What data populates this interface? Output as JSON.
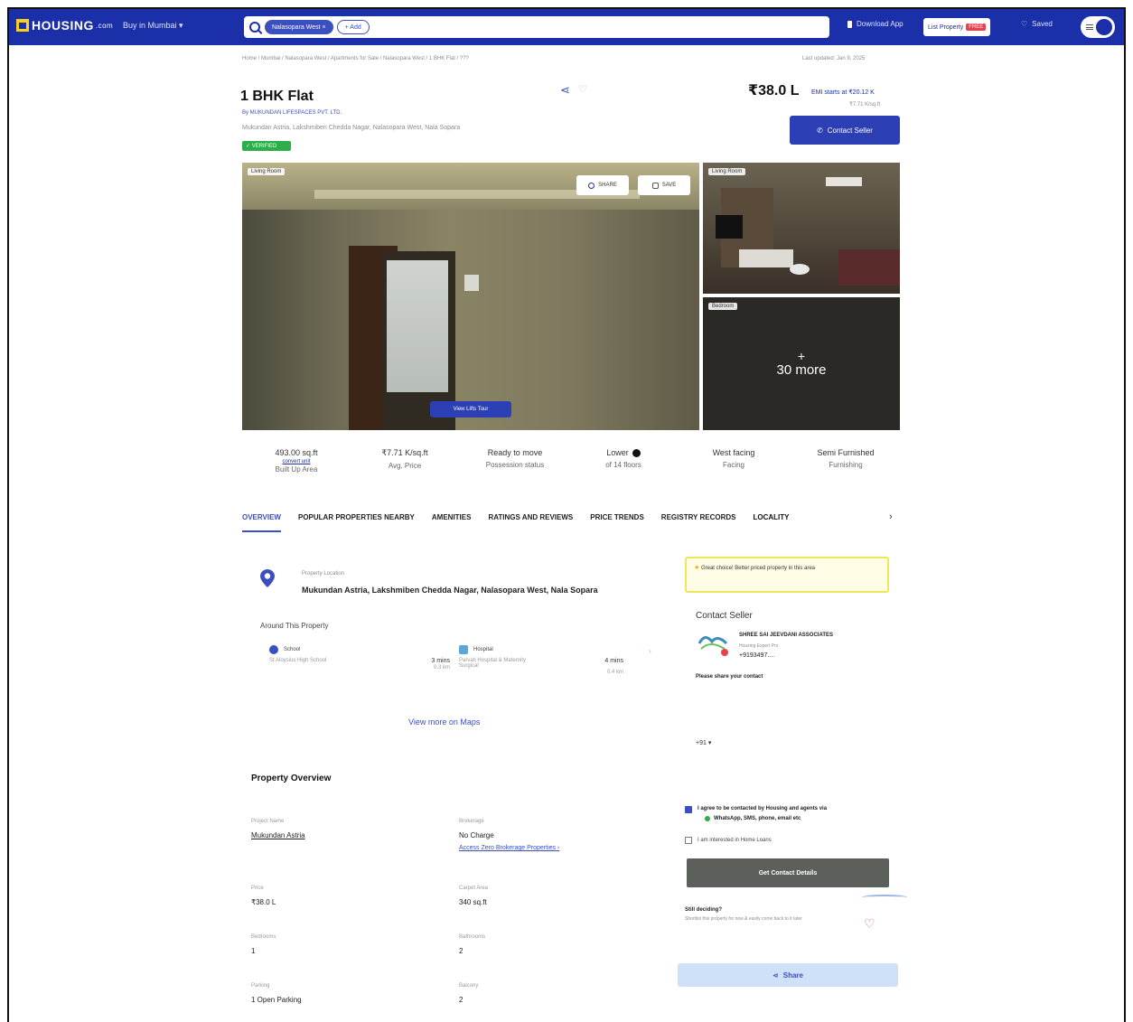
{
  "topnav": {
    "logo_text": "HOUSING",
    "logo_suffix": ".com",
    "city_selector": "Buy in Mumbai",
    "search_chip": "Nalasopara West",
    "search_add": "+ Add",
    "download_app": "Download App",
    "list_property": "List Property",
    "free_badge": "FREE",
    "saved": "Saved"
  },
  "breadcrumb": "Home / Mumbai / Nalasopara West / Apartments for Sale / Nalasopara West / 1 BHK Flat / ???",
  "last_updated": "Last updated: Jan 9, 2025",
  "listing": {
    "title": "1 BHK Flat",
    "developer": "By MUKUNDAN LIFESPACES PVT. LTD.",
    "address_line": "Mukundan Astria, Lakshmiben Chedda Nagar, Nalasopara West, Nala Sopara",
    "verified_badge": "✓ VERIFIED",
    "price": "₹38.0 L",
    "emi": "EMI starts at ₹20.12 K",
    "price_per_sqft": "₹7.71 K/sq.ft",
    "contact_button": "Contact Seller"
  },
  "gallery": {
    "main_tag": "Living Room",
    "share_label": "SHARE",
    "save_label": "SAVE",
    "tour_label": "View Lifts Tour",
    "side1_tag": "Living Room",
    "side2_tag": "Bedroom",
    "more_plus": "+",
    "more_label": "30 more"
  },
  "facts": [
    {
      "value": "493.00 sq.ft",
      "link": "convert unit",
      "label": "Built Up Area"
    },
    {
      "value": "₹7.71 K/sq.ft",
      "label": "Avg. Price"
    },
    {
      "value": "Ready to move",
      "label": "Possession status"
    },
    {
      "value": "Lower",
      "label": "of 14 floors"
    },
    {
      "value": "West facing",
      "label": "Facing"
    },
    {
      "value": "Semi Furnished",
      "label": "Furnishing"
    }
  ],
  "tabs": [
    "OVERVIEW",
    "POPULAR PROPERTIES NEARBY",
    "AMENITIES",
    "RATINGS AND REVIEWS",
    "PRICE TRENDS",
    "REGISTRY RECORDS",
    "LOCALITY"
  ],
  "tabs_next": "›",
  "location": {
    "label": "Property Location",
    "address": "Mukundan Astria, Lakshmiben Chedda Nagar, Nalasopara West, Nala Sopara",
    "around_title": "Around This Property",
    "pois": [
      {
        "category": "School",
        "name": "St Aloysius High School",
        "time": "3 mins",
        "distance": "0.3 km",
        "icon_color": "#3b4fbf"
      },
      {
        "category": "Hospital",
        "name": "Parvati Hospital & Maternity Surgical",
        "time": "4 mins",
        "distance": "0.4 km",
        "icon_color": "#5aa8d6"
      }
    ],
    "maps_link": "View more on Maps"
  },
  "contact_panel": {
    "promo": "Great choice! Better priced property in this area",
    "title": "Contact Seller",
    "agent_name": "SHREE SAI JEEVDANI ASSOCIATES",
    "agent_role": "Housing Expert Pro",
    "phone": "+9193497....",
    "share_prompt": "Please share your contact",
    "country_code": "+91 ▾",
    "agree_text": "I agree to be contacted by Housing and agents via",
    "agree_channels": "WhatsApp, SMS, phone, email etc",
    "loan_text": "I am interested in Home Loans",
    "get_details": "Get Contact Details",
    "still_deciding": "Still deciding?",
    "still_sub": "Shortlist this property for now & easily come back to it later",
    "share_button": "Share"
  },
  "overview": {
    "title": "Property Overview",
    "items": [
      {
        "label": "Project Name",
        "value": "Mukundan Astria",
        "link": true
      },
      {
        "label": "Brokerage",
        "value": "No Charge",
        "sub_link": "Access Zero Brokerage Properties ›"
      },
      {
        "label": "Price",
        "value": "₹38.0 L"
      },
      {
        "label": "Carpet Area",
        "value": "340 sq.ft"
      },
      {
        "label": "Bedrooms",
        "value": "1"
      },
      {
        "label": "Bathrooms",
        "value": "2"
      },
      {
        "label": "Parking",
        "value": "1 Open Parking"
      },
      {
        "label": "Balcony",
        "value": "2"
      }
    ]
  },
  "colors": {
    "brand": "#1a2fa8",
    "accent": "#3b4fbf",
    "verified": "#2cae4a"
  }
}
